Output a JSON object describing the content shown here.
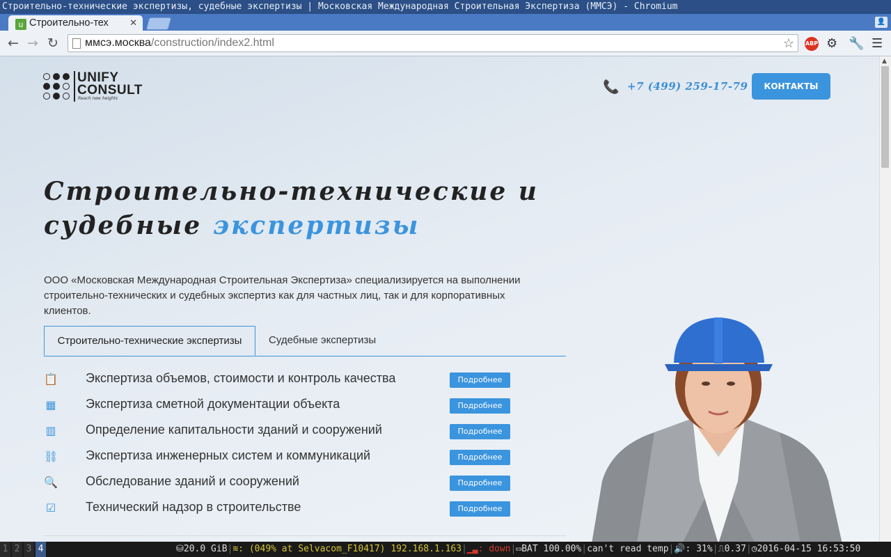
{
  "window": {
    "title": "Строительно-технические экспертизы, судебные экспертизы | Московская Международная Строительная Экспертиза (ММСЭ) - Chromium"
  },
  "browser": {
    "tab_title": "Строительно-тех",
    "favicon": "u",
    "url_host": "ммсэ.москва",
    "url_path": "/construction/index2.html",
    "abp_label": "ABP",
    "accent_color": "#4a7ac4"
  },
  "header": {
    "logo_line1": "UNIFY",
    "logo_line2": "CONSULT",
    "logo_tagline": "Reach new heights",
    "phone": "+7 (499) 259-17-79",
    "contacts_button": "КОНТАКТЫ"
  },
  "hero": {
    "headline_part1": "Строительно-технические и судебные",
    "headline_accent": "экспертизы",
    "intro": "ООО «Московская Международная Строительная Экспертиза» специализируется на выполнении строительно-технических и судебных экспертиз как для частных лиц, так и для корпоративных клиентов."
  },
  "tabs": [
    {
      "label": "Строительно-технические экспертизы",
      "active": true
    },
    {
      "label": "Судебные экспертизы",
      "active": false
    }
  ],
  "services": [
    {
      "icon": "clipboard-icon",
      "label": "Экспертиза объемов, стоимости и контроль качества",
      "button": "Подробнее"
    },
    {
      "icon": "calculator-icon",
      "label": "Экспертиза сметной документации объекта",
      "button": "Подробнее"
    },
    {
      "icon": "buildings-icon",
      "label": "Определение капитальности зданий и сооружений",
      "button": "Подробнее"
    },
    {
      "icon": "network-icon",
      "label": "Экспертиза инженерных систем и коммуникаций",
      "button": "Подробнее"
    },
    {
      "icon": "search-icon",
      "label": "Обследование зданий и сооружений",
      "button": "Подробнее"
    },
    {
      "icon": "checkbox-icon",
      "label": "Технический надзор в строительстве",
      "button": "Подробнее"
    }
  ],
  "statusbar": {
    "workspaces": [
      "1",
      "2",
      "3",
      "4"
    ],
    "active_workspace": "4",
    "disk": "20.0 GiB",
    "wifi": "(049% at Selvacom_F10417) 192.168.1.163",
    "net_label": "down",
    "battery": "BAT 100.00%",
    "temp": "can't read temp",
    "volume": "31%",
    "load": "0.37",
    "datetime": "2016-04-15 16:53:50"
  }
}
